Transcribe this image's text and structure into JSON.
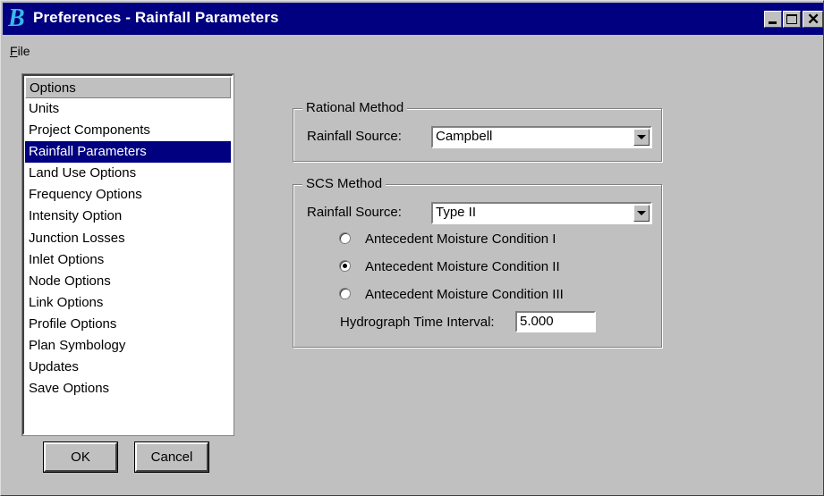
{
  "window": {
    "title": "Preferences - Rainfall Parameters",
    "icon": "bentley-b-icon",
    "controls": [
      "minimize-icon",
      "maximize-icon",
      "close-icon"
    ]
  },
  "menu": {
    "file_mnemonic": "F",
    "file_rest": "ile"
  },
  "options": {
    "header": "Options",
    "items": [
      {
        "label": "Units"
      },
      {
        "label": "Project Components"
      },
      {
        "label": "Rainfall Parameters",
        "selected": true
      },
      {
        "label": "Land Use Options"
      },
      {
        "label": "Frequency Options"
      },
      {
        "label": "Intensity Option"
      },
      {
        "label": "Junction Losses"
      },
      {
        "label": "Inlet Options"
      },
      {
        "label": "Node Options"
      },
      {
        "label": "Link Options"
      },
      {
        "label": "Profile Options"
      },
      {
        "label": "Plan Symbology"
      },
      {
        "label": "Updates"
      },
      {
        "label": "Save Options"
      }
    ]
  },
  "buttons": {
    "ok": "OK",
    "cancel": "Cancel"
  },
  "rational": {
    "title": "Rational Method",
    "source_label": "Rainfall Source:",
    "source_value": "Campbell"
  },
  "scs": {
    "title": "SCS Method",
    "source_label": "Rainfall Source:",
    "source_value": "Type II",
    "radios": [
      {
        "label": "Antecedent Moisture Condition I",
        "checked": false
      },
      {
        "label": "Antecedent Moisture Condition II",
        "checked": true
      },
      {
        "label": "Antecedent Moisture Condition III",
        "checked": false
      }
    ],
    "interval_label": "Hydrograph Time Interval:",
    "interval_value": "5.000"
  },
  "colors": {
    "titlebar": "#000080",
    "selection": "#000080",
    "face": "#c0c0c0"
  }
}
